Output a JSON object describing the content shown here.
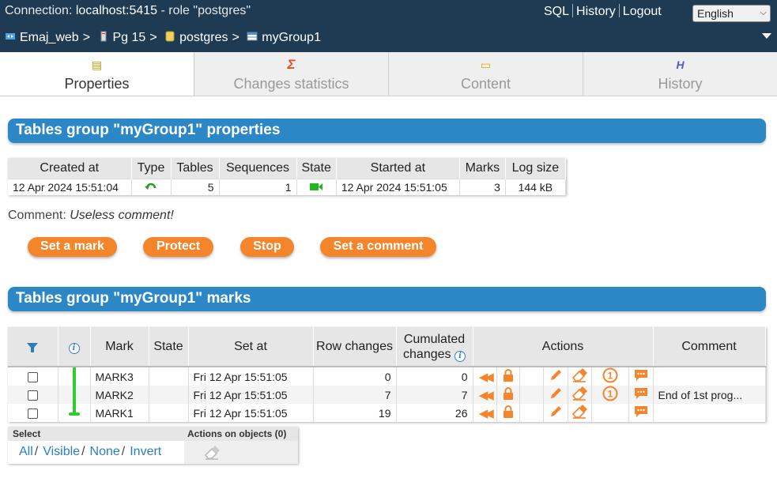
{
  "header": {
    "connection_prefix": "Connection:",
    "connection_host": "localhost:5415",
    "connection_role": "- role \"postgres\"",
    "links": [
      "SQL",
      "History",
      "Logout"
    ],
    "language": "English",
    "breadcrumb": [
      "Emaj_web",
      "Pg 15",
      "postgres",
      "myGroup1"
    ]
  },
  "tabs": [
    {
      "label": "Properties",
      "icon": "📇",
      "active": true
    },
    {
      "label": "Changes statistics",
      "icon": "Σ"
    },
    {
      "label": "Content",
      "icon": "🗀"
    },
    {
      "label": "History",
      "icon": "H"
    }
  ],
  "properties": {
    "title": "Tables group \"myGroup1\" properties",
    "columns": [
      "Created at",
      "Type",
      "Tables",
      "Sequences",
      "State",
      "Started at",
      "Marks",
      "Log size"
    ],
    "row": {
      "created_at": "12 Apr 2024 15:51:04",
      "type_icon": "rollbackable-icon",
      "tables": "5",
      "sequences": "1",
      "state_icon": "logging-started-icon",
      "started_at": "12 Apr 2024 15:51:05",
      "marks": "3",
      "log_size": "144 kB"
    },
    "comment_label": "Comment:",
    "comment_value": "Useless comment!",
    "buttons": [
      "Set a mark",
      "Protect",
      "Stop",
      "Set a comment"
    ]
  },
  "marks": {
    "title": "Tables group \"myGroup1\" marks",
    "columns": {
      "mark": "Mark",
      "state": "State",
      "set_at": "Set at",
      "row_changes": "Row changes",
      "cumulated_1": "Cumulated",
      "cumulated_2": "changes",
      "actions": "Actions",
      "comment": "Comment"
    },
    "rows": [
      {
        "mark": "MARK3",
        "state": "",
        "set_at": "Fri 12 Apr 15:51:05",
        "row_changes": "0",
        "cumulated": "0",
        "first_mark": true,
        "comment": ""
      },
      {
        "mark": "MARK2",
        "state": "",
        "set_at": "Fri 12 Apr 15:51:05",
        "row_changes": "7",
        "cumulated": "7",
        "first_mark": true,
        "comment": "End of 1st prog..."
      },
      {
        "mark": "MARK1",
        "state": "",
        "set_at": "Fri 12 Apr 15:51:05",
        "row_changes": "19",
        "cumulated": "26",
        "first_mark": false,
        "comment": ""
      }
    ],
    "select_label": "Select",
    "actions_on_objects": "Actions on objects (0)",
    "select_links": [
      "All",
      "Visible",
      "None",
      "Invert"
    ]
  },
  "colors": {
    "topbar": "#1f3a53",
    "section": "#2b87c6",
    "button": "#f4852b",
    "timeline": "#2ecc2e"
  }
}
